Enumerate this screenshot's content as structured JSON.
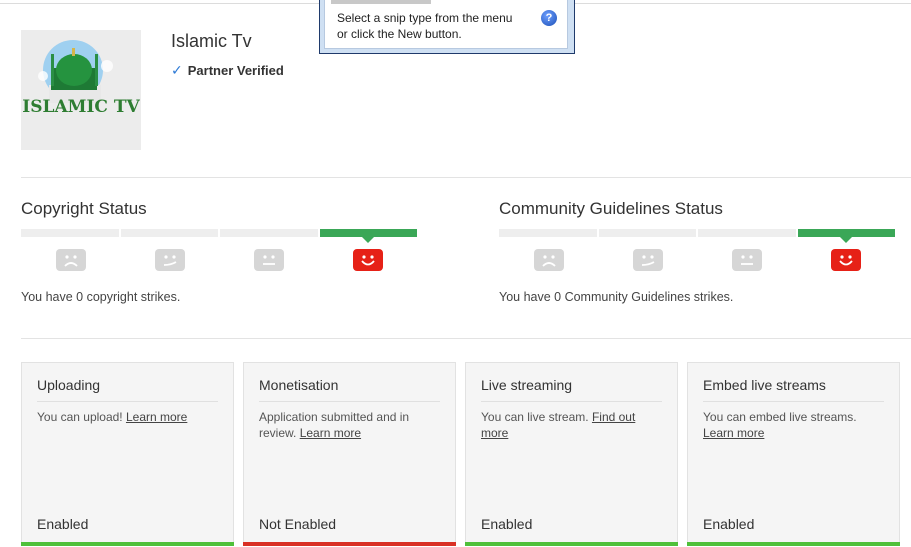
{
  "snip_tool": {
    "line1": "Select a snip type from the menu",
    "line2": "or click the New button.",
    "help_icon": "?"
  },
  "channel": {
    "name": "Islamic Tv",
    "verified_label": "Partner Verified",
    "logo_text": "ISLAMIC TV"
  },
  "copyright": {
    "title": "Copyright Status",
    "strikes_text": "You have 0 copyright strikes.",
    "active_index": 3
  },
  "community": {
    "title": "Community Guidelines Status",
    "strikes_text": "You have 0 Community Guidelines strikes.",
    "active_index": 3
  },
  "cards": [
    {
      "title": "Uploading",
      "desc": "You can upload! ",
      "link": "Learn more",
      "status": "Enabled",
      "bar_color": "#4fc03a"
    },
    {
      "title": "Monetisation",
      "desc": "Application submitted and in review. ",
      "link": "Learn more",
      "status": "Not Enabled",
      "bar_color": "#d93025"
    },
    {
      "title": "Live streaming",
      "desc": "You can live stream. ",
      "link": "Find out more",
      "status": "Enabled",
      "bar_color": "#4fc03a"
    },
    {
      "title": "Embed live streams",
      "desc": "You can embed live streams. ",
      "link": "Learn more",
      "status": "Enabled",
      "bar_color": "#4fc03a"
    }
  ],
  "colors": {
    "accent_green": "#3aa757",
    "active_face_red": "#e62117",
    "verified_check": "#2d7ad6"
  }
}
